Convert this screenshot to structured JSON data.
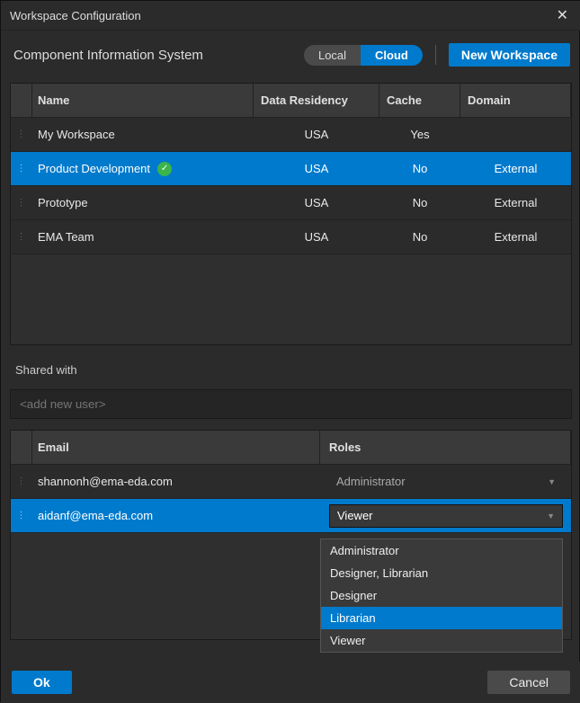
{
  "window": {
    "title": "Workspace Configuration"
  },
  "header": {
    "subtitle": "Component Information System",
    "toggle": {
      "local": "Local",
      "cloud": "Cloud",
      "active": "cloud"
    },
    "newWorkspace": "New Workspace"
  },
  "workspaces": {
    "headers": {
      "name": "Name",
      "residency": "Data Residency",
      "cache": "Cache",
      "domain": "Domain"
    },
    "rows": [
      {
        "name": "My Workspace",
        "residency": "USA",
        "cache": "Yes",
        "domain": "",
        "selected": false,
        "verified": false
      },
      {
        "name": "Product Development",
        "residency": "USA",
        "cache": "No",
        "domain": "External",
        "selected": true,
        "verified": true
      },
      {
        "name": "Prototype",
        "residency": "USA",
        "cache": "No",
        "domain": "External",
        "selected": false,
        "verified": false
      },
      {
        "name": "EMA Team",
        "residency": "USA",
        "cache": "No",
        "domain": "External",
        "selected": false,
        "verified": false
      }
    ]
  },
  "share": {
    "label": "Shared with",
    "addUserPlaceholder": "<add new user>",
    "headers": {
      "email": "Email",
      "roles": "Roles"
    },
    "rows": [
      {
        "email": "shannonh@ema-eda.com",
        "role": "Administrator",
        "selected": false,
        "editable": false
      },
      {
        "email": "aidanf@ema-eda.com",
        "role": "Viewer",
        "selected": true,
        "editable": true
      }
    ],
    "roleOptions": [
      "Administrator",
      "Designer, Librarian",
      "Designer",
      "Librarian",
      "Viewer"
    ],
    "highlightedOption": "Librarian"
  },
  "footer": {
    "ok": "Ok",
    "cancel": "Cancel"
  }
}
